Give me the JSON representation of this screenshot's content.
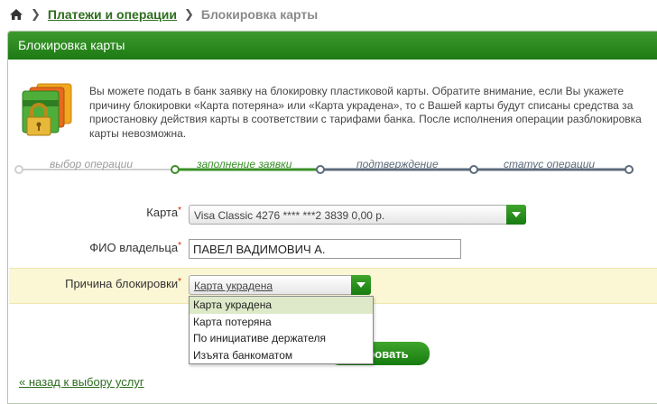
{
  "breadcrumb": {
    "home_icon": "home-icon",
    "link_label": "Платежи и операции",
    "current_label": "Блокировка карты"
  },
  "panel": {
    "title": "Блокировка карты"
  },
  "info": {
    "icon": "locked-cards-icon",
    "text": "Вы можете подать в банк заявку на блокировку пластиковой карты. Обратите внимание, если Вы укажете причину блокировки «Карта потеряна» или «Карта украдена», то с Вашей карты будут списаны средства за приостановку действия карты в соответствии с тарифами банка. После исполнения операции разблокировка карты невозможна."
  },
  "steps": [
    {
      "label": "выбор операции",
      "state": "done"
    },
    {
      "label": "заполнение заявки",
      "state": "active"
    },
    {
      "label": "подтверждение",
      "state": "pending"
    },
    {
      "label": "статус операции",
      "state": "pending"
    }
  ],
  "colors": {
    "accent_green": "#3a8f27",
    "muted_gray": "#9a9a9a",
    "pending_slate": "#5b6b7a"
  },
  "form": {
    "card": {
      "label": "Карта",
      "required_mark": "*",
      "value": "Visa Classic  4276 **** ***2 3839  0,00  р."
    },
    "owner": {
      "label": "ФИО владельца",
      "required_mark": "*",
      "value": "ПАВЕЛ ВАДИМОВИЧ А."
    },
    "reason": {
      "label": "Причина блокировки",
      "required_mark": "*",
      "value": "Карта украдена",
      "options": [
        "Карта украдена",
        "Карта потеряна",
        "По инициативе держателя",
        "Изъята банкоматом"
      ]
    }
  },
  "submit_label": "ировать",
  "back_link": "« назад к выбору услуг"
}
